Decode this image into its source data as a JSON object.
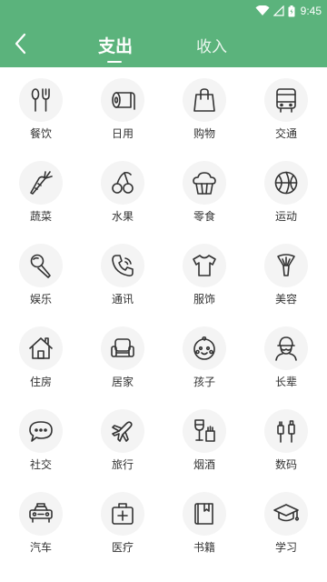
{
  "status_bar": {
    "time": "9:45",
    "icons": [
      "wifi-icon",
      "signal-icon",
      "battery-icon"
    ]
  },
  "header": {
    "back_icon": "chevron-left-icon",
    "tabs": [
      {
        "label": "支出",
        "active": true
      },
      {
        "label": "收入",
        "active": false
      }
    ]
  },
  "categories": [
    {
      "label": "餐饮",
      "icon": "utensils-icon"
    },
    {
      "label": "日用",
      "icon": "tissue-roll-icon"
    },
    {
      "label": "购物",
      "icon": "shopping-bag-icon"
    },
    {
      "label": "交通",
      "icon": "bus-icon"
    },
    {
      "label": "蔬菜",
      "icon": "carrot-icon"
    },
    {
      "label": "水果",
      "icon": "cherry-icon"
    },
    {
      "label": "零食",
      "icon": "cupcake-icon"
    },
    {
      "label": "运动",
      "icon": "basketball-icon"
    },
    {
      "label": "娱乐",
      "icon": "microphone-icon"
    },
    {
      "label": "通讯",
      "icon": "phone-icon"
    },
    {
      "label": "服饰",
      "icon": "tshirt-icon"
    },
    {
      "label": "美容",
      "icon": "makeup-brush-icon"
    },
    {
      "label": "住房",
      "icon": "house-icon"
    },
    {
      "label": "居家",
      "icon": "armchair-icon"
    },
    {
      "label": "孩子",
      "icon": "baby-face-icon"
    },
    {
      "label": "长辈",
      "icon": "elder-icon"
    },
    {
      "label": "社交",
      "icon": "chat-bubble-icon"
    },
    {
      "label": "旅行",
      "icon": "airplane-icon"
    },
    {
      "label": "烟酒",
      "icon": "wine-cigarette-icon"
    },
    {
      "label": "数码",
      "icon": "cables-icon"
    },
    {
      "label": "汽车",
      "icon": "taxi-icon"
    },
    {
      "label": "医疗",
      "icon": "medical-bag-icon"
    },
    {
      "label": "书籍",
      "icon": "book-icon"
    },
    {
      "label": "学习",
      "icon": "graduation-cap-icon"
    }
  ],
  "colors": {
    "header_bg": "#5bb37c",
    "icon_stroke": "#333333",
    "icon_circle_bg": "#f4f4f4",
    "label_text": "#333333"
  }
}
